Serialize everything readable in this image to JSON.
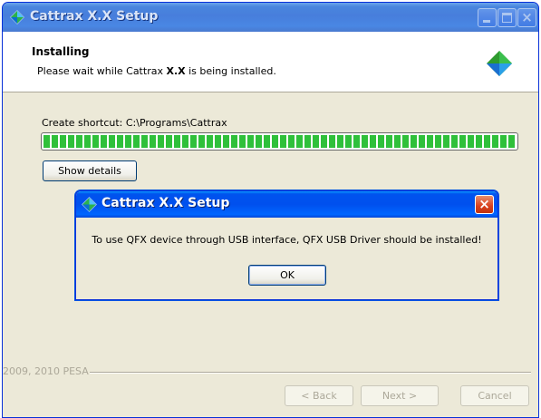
{
  "window": {
    "title": "Cattrax  X.X Setup",
    "controls": {
      "minimize": "minimize",
      "maximize": "maximize",
      "close": "×"
    }
  },
  "header": {
    "title": "Installing",
    "subtitle_prefix": "Please wait while Cattrax ",
    "subtitle_bold": "X.X",
    "subtitle_suffix": "  is being installed."
  },
  "progress": {
    "status": "Create shortcut: C:\\Programs\\Cattrax",
    "fraction": 1.0
  },
  "buttons": {
    "show_details": "Show details",
    "back": "< Back",
    "next": "Next >",
    "cancel": "Cancel"
  },
  "branding": {
    "text": "2009, 2010 PESA"
  },
  "dialog": {
    "title": "Cattrax X.X Setup",
    "message": "To use QFX device through USB interface, QFX USB Driver should be installed!",
    "ok": "OK",
    "close": "×"
  },
  "colors": {
    "brand_green": "#2e9b2e",
    "brand_blue": "#1a6fd0",
    "progress": "#2fc03a"
  },
  "icons": [
    "app-logo-icon",
    "minimize-icon",
    "maximize-icon",
    "close-icon"
  ]
}
